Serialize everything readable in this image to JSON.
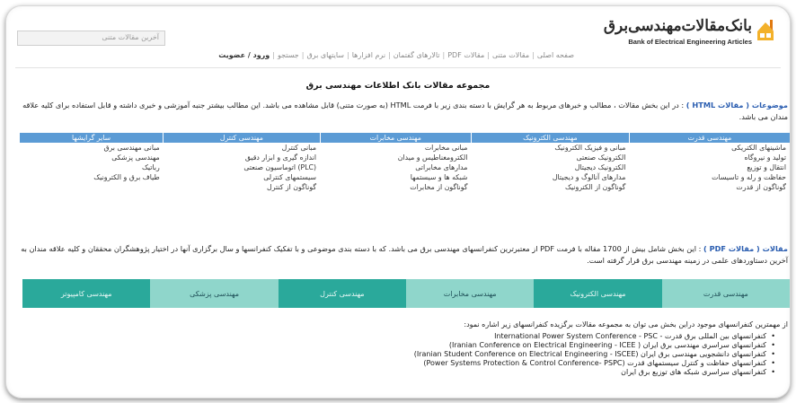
{
  "header": {
    "logo_fa": "بانک‌مقالات‌مهندسی‌برق",
    "logo_en": "Bank of Electrical Engineering Articles",
    "search_placeholder": "آخرین مقالات متنی"
  },
  "nav": [
    {
      "label": "صفحه اصلی"
    },
    {
      "label": "مقالات متنی"
    },
    {
      "label": "مقالات PDF"
    },
    {
      "label": "تالارهای گفتمان"
    },
    {
      "label": "نرم افزارها"
    },
    {
      "label": "سایتهای برق"
    },
    {
      "label": "جستجو"
    },
    {
      "label": "ورود / عضویت",
      "bold": true
    }
  ],
  "page_title": "مجموعه مقالات بانک اطلاعات مهندسی برق",
  "html_section": {
    "heading": "موضوعات ( مقالات HTML )",
    "text": ": در این بخش مقالات ، مطالب و خبرهای مربوط به هر گرایش با دسته بندی زیر با فرمت HTML (به صورت متنی) قابل مشاهده می باشد. این مطالب بیشتر جنبه آموزشی و خبری داشته و قابل استفاده برای کلیه علاقه مندان می باشد."
  },
  "categories": {
    "headers": [
      "مهندسی قدرت",
      "مهندسی الکترونیک",
      "مهندسی مخابرات",
      "مهندسی کنترل",
      "سایر گرایشها"
    ],
    "rows": [
      [
        "ماشینهای الکتریکی",
        "مبانی و فیزیک الکترونیک",
        "مبانی مخابرات",
        "مبانی کنترل",
        "مبانی مهندسی برق"
      ],
      [
        "تولید و نیروگاه",
        "الکترونیک صنعتی",
        "الکترومغناطیس و میدان",
        "اندازه گیری و ابزار دقیق",
        "مهندسی پزشکی"
      ],
      [
        "انتقال و توزیع",
        "الکترونیک دیجیتال",
        "مدارهای مخابراتی",
        "(PLC) اتوماسیون صنعتی",
        "رباتیک"
      ],
      [
        "حفاظت و رله و تاسیسات",
        "مدارهای آنالوگ و دیجیتال",
        "شبکه ها و سیستمها",
        "سیستمهای کنترلی",
        "طیاف برق و الکترونیک"
      ],
      [
        "گوناگون از قدرت",
        "گوناگون از الکترونیک",
        "گوناگون از مخابرات",
        "گوناگون از کنترل",
        ""
      ]
    ]
  },
  "pdf_section": {
    "heading": "مقالات ( مقالات PDF )",
    "text": ": این بخش شامل بیش از 1700 مقاله با فرمت PDF از معتبرترین کنفرانسهای مهندسی برق می باشد. که با دسته بندی موضوعی و با تفکیک کنفرانسها و سال برگزاری آنها در اختیار پژوهشگران محققان و کلیه علاقه مندان به آخرین دستاوردهای علمی در زمینه مهندسی برق قرار گرفته است."
  },
  "tabs": [
    {
      "label": "مهندسی قدرت",
      "style": "light"
    },
    {
      "label": "مهندسی الکترونیک",
      "style": "dark"
    },
    {
      "label": "مهندسی مخابرات",
      "style": "light"
    },
    {
      "label": "مهندسی کنترل",
      "style": "dark"
    },
    {
      "label": "مهندسی پزشکی",
      "style": "light"
    },
    {
      "label": "مهندسی کامپیوتر",
      "style": "dark"
    }
  ],
  "list_intro": "از مهمترین کنفرانسهای موجود دراین بخش می توان به مجموعه مقالات برگزیده کنفرانسهای زیر اشاره نمود:",
  "conferences": [
    "کنفرانسهای بین المللی برق قدرت - International Power System Conference - PSC",
    "کنفرانسهای سراسری مهندسی برق ایران ( Iranian Conference on Electrical Engineering - ICEE)",
    "کنفرانسهای دانشجویی مهندسی برق ایران (Iranian Student Conference on Electrical Engineering - ISCEE)",
    "کنفرانسهای حفاظت و کنترل سیستمهای قدرت (Power Systems Protection & Control Conference- PSPC)",
    "کنفرانسهای سراسری شبکه های توزیع برق ایران"
  ],
  "colors": {
    "table_header": "#5b9bd5",
    "tab_light": "#8fd6cb",
    "tab_dark": "#2aa99b",
    "heading_blue": "#2a5db0"
  }
}
